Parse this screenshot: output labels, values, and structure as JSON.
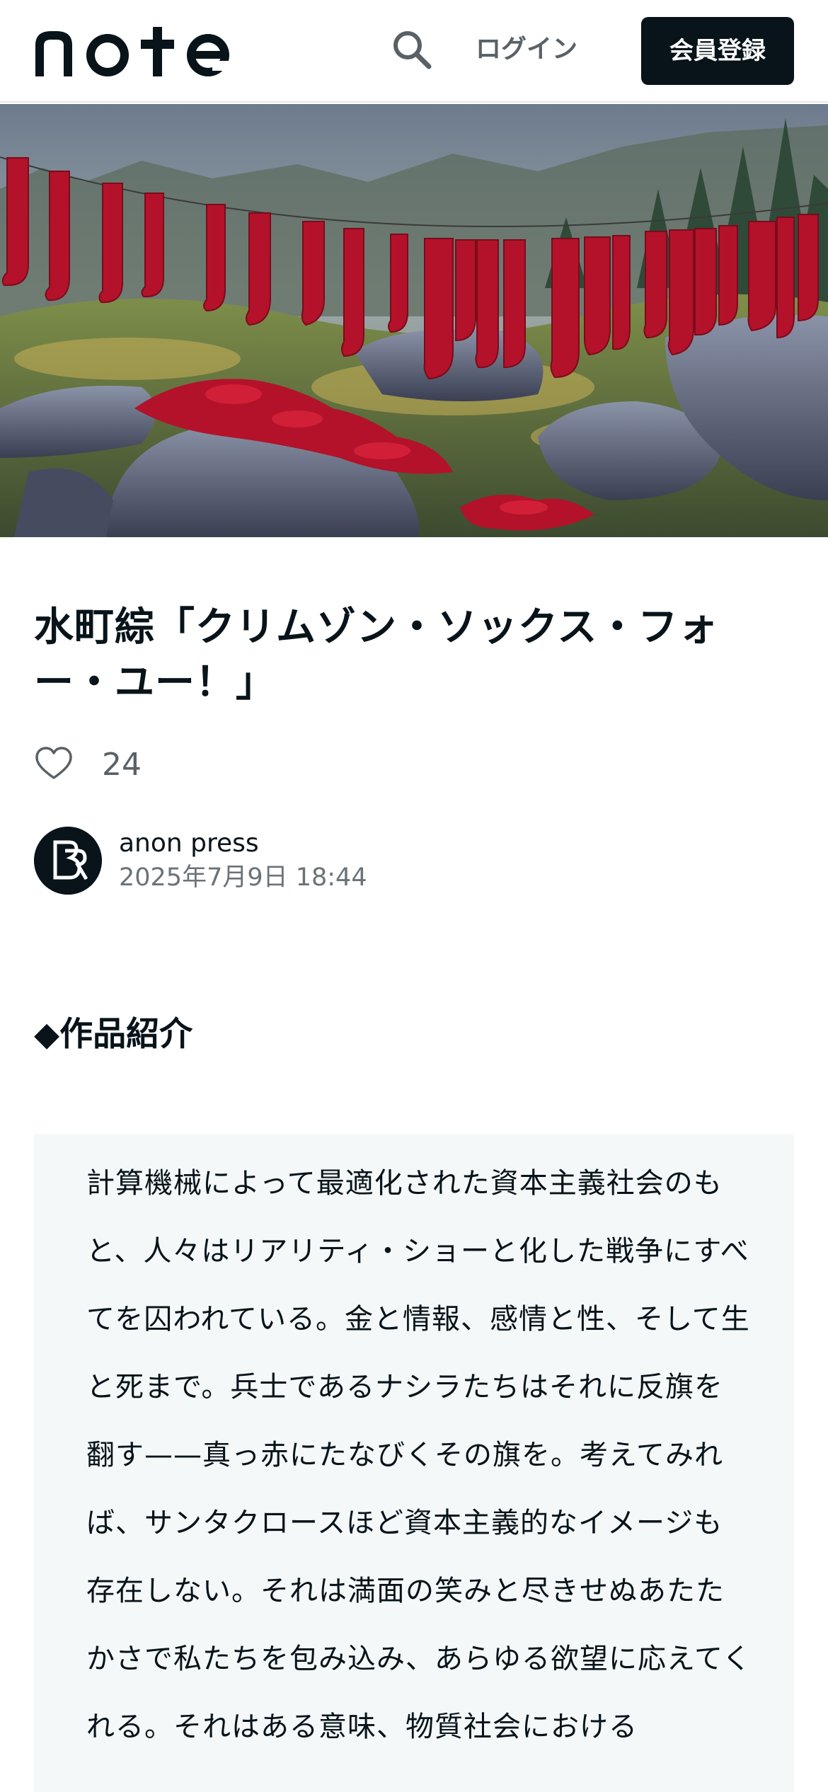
{
  "header": {
    "logo_text": "note",
    "search_icon": "search-icon",
    "login_label": "ログイン",
    "signup_label": "会員登録"
  },
  "hero": {
    "image_description_icon": "hero-image"
  },
  "article": {
    "title": "水町綜「クリムゾン・ソックス・フォー・ユー！」",
    "like_icon": "heart-icon",
    "like_count": "24",
    "author_name": "anon press",
    "date": "2025年7月9日 18:44",
    "section_heading": "◆作品紹介",
    "quote": "計算機械によって最適化された資本主義社会のもと、人々はリアリティ・ショーと化した戦争にすべてを囚われている。金と情報、感情と性、そして生と死まで。兵士であるナシラたちはそれに反旗を翻す——真っ赤にたなびくその旗を。考えてみれば、サンタクロースほど資本主義的なイメージも存在しない。それは満面の笑みと尽きせぬあたたかさで私たちを包み込み、あらゆる欲望に応えてくれる。それはある意味、物質社会における"
  },
  "colors": {
    "ink": "#08131a",
    "muted": "#5a6166",
    "quote_bg": "#f4f8f8",
    "sock_red": "#b3122a"
  }
}
